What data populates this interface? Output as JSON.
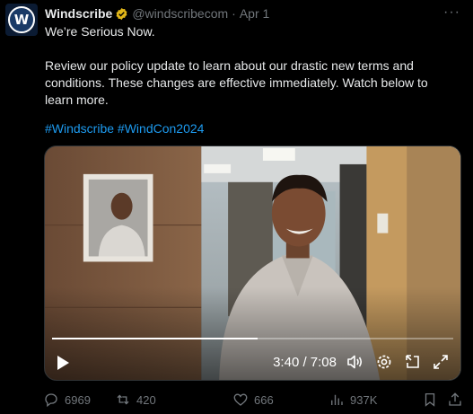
{
  "tweet": {
    "author_name": "Windscribe",
    "handle": "@windscribecom",
    "separator": "·",
    "date": "Apr 1",
    "more_label": "···",
    "avatar_letter": "W",
    "line1": "We’re Serious Now.",
    "body": "Review our policy update to learn about our drastic new  terms and conditions. These changes are effective immediately. Watch below to learn more.",
    "hashtags": [
      "#Windscribe",
      "#WindCon2024"
    ]
  },
  "video": {
    "current_time": "3:40",
    "duration": "7:08",
    "time_display": "3:40 / 7:08",
    "progress_fraction": 0.513
  },
  "actions": {
    "replies": "6969",
    "reposts": "420",
    "likes": "666",
    "views": "937K"
  },
  "colors": {
    "background": "#000000",
    "text": "#e7e9ea",
    "muted": "#71767b",
    "link": "#1d9bf0",
    "verified_badge": "#e2b719"
  }
}
